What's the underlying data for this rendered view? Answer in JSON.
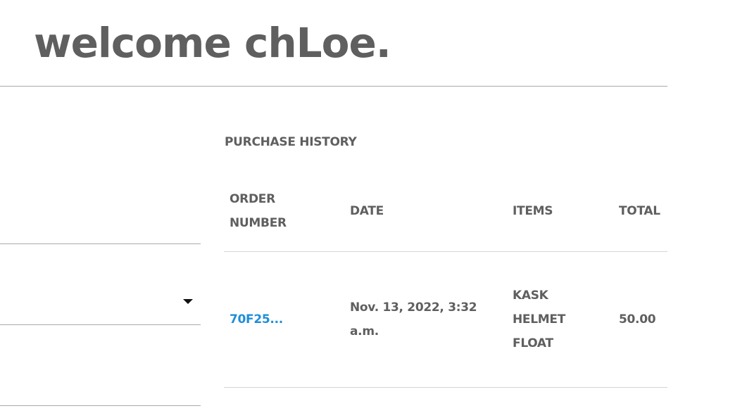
{
  "header": {
    "welcome": "welcome chLoe."
  },
  "purchase_history": {
    "title": "PURCHASE HISTORY",
    "columns": {
      "order_number": "ORDER NUMBER",
      "date": "DATE",
      "items": "ITEMS",
      "total": "TOTAL"
    },
    "rows": [
      {
        "order_number": "70F25...",
        "date": "Nov. 13, 2022, 3:32 a.m.",
        "items": [
          "KASK",
          "HELMET",
          "FLOAT"
        ],
        "total": "50.00"
      }
    ]
  },
  "colors": {
    "text": "#5f5f5f",
    "link": "#1e8fd8",
    "rule": "#a9a9a9"
  }
}
